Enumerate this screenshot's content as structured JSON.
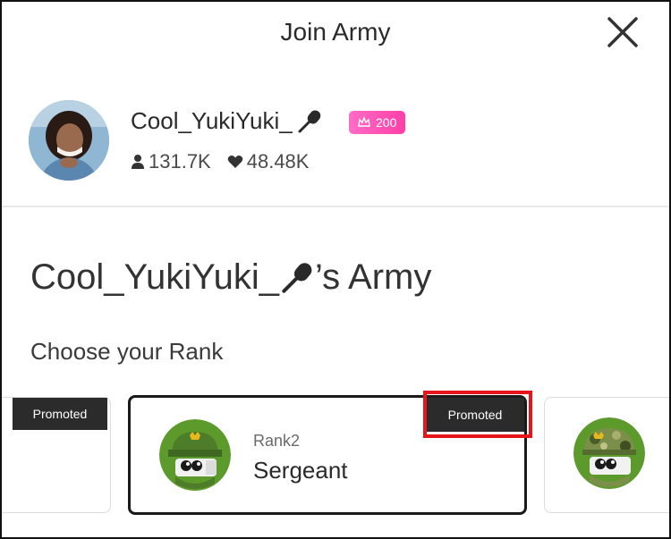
{
  "header": {
    "title": "Join Army"
  },
  "user": {
    "name": "Cool_YukiYuki_",
    "badge_value": "200",
    "followers": "131.7K",
    "likes": "48.48K"
  },
  "army": {
    "title_suffix": "’s Army"
  },
  "rank_section": {
    "label": "Choose your Rank"
  },
  "cards": {
    "left": {
      "tag": "Promoted"
    },
    "main": {
      "tag": "Promoted",
      "rank_number": "Rank2",
      "rank_name": "Sergeant"
    }
  },
  "colors": {
    "badge_gradient_start": "#ff6cc6",
    "badge_gradient_end": "#ff3fa8",
    "highlight": "#e8141b",
    "tag_bg": "#2b2b2b"
  },
  "icons": [
    "close-icon",
    "microphone-icon",
    "crown-icon",
    "person-icon",
    "heart-icon",
    "soldier-avatar-icon"
  ]
}
